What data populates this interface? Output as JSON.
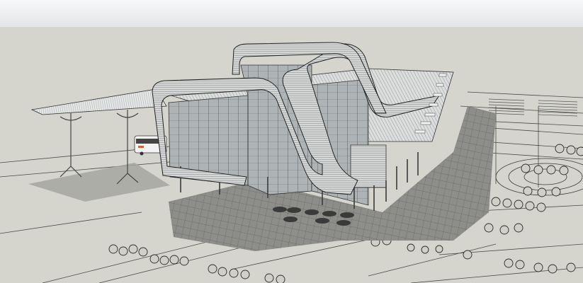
{
  "scene": {
    "sky_top": "#f6f7f8",
    "sky_bottom": "#e3e5e7",
    "ground": "#d6d6cf",
    "shadow": "#8e8e8a",
    "building_fill": "#c9cccc",
    "roof_fill": "#dfe1e1",
    "line": "#2c2c2c",
    "glass": "#9fa6aa"
  }
}
